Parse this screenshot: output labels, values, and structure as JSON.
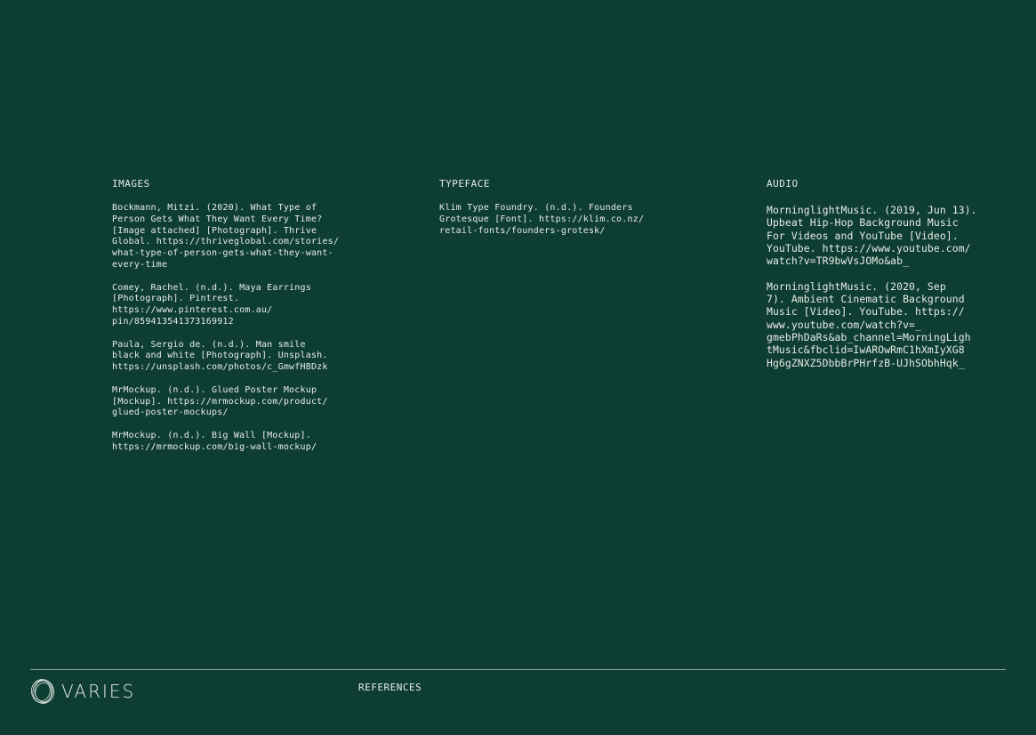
{
  "images": {
    "heading": "IMAGES",
    "entries": [
      [
        "Bockmann, Mitzi. (2020). What Type of",
        "Person Gets What They Want Every Time?",
        "[Image attached] [Photograph]. Thrive",
        "Global. https://thriveglobal.com/stories/",
        "what-type-of-person-gets-what-they-want-",
        "every-time"
      ],
      [
        "Comey, Rachel. (n.d.). Maya Earrings",
        "[Photograph]. Pintrest.",
        "https://www.pinterest.com.au/",
        "pin/859413541373169912"
      ],
      [
        "Paula, Sergio de. (n.d.). Man smile",
        "black and white [Photograph]. Unsplash.",
        "https://unsplash.com/photos/c_GmwfHBDzk"
      ],
      [
        "MrMockup. (n.d.). Glued Poster Mockup",
        "[Mockup]. https://mrmockup.com/product/",
        "glued-poster-mockups/"
      ],
      [
        "MrMockup. (n.d.). Big Wall [Mockup].",
        "https://mrmockup.com/big-wall-mockup/"
      ]
    ]
  },
  "typeface": {
    "heading": "TYPEFACE",
    "entries": [
      [
        "Klim Type Foundry. (n.d.). Founders",
        "Grotesque [Font]. https://klim.co.nz/",
        "retail-fonts/founders-grotesk/"
      ]
    ]
  },
  "audio": {
    "heading": "AUDIO",
    "entries": [
      [
        "MorninglightMusic. (2019, Jun 13).",
        "Upbeat Hip-Hop Background Music",
        "For Videos and YouTube [Video].",
        "YouTube. https://www.youtube.com/",
        "watch?v=TR9bwVsJOMo&ab_"
      ],
      [
        "MorninglightMusic. (2020, Sep",
        "7). Ambient Cinematic Background",
        "Music [Video]. YouTube. https://",
        "www.youtube.com/watch?v=_",
        "gmebPhDaRs&ab_channel=MorningLigh",
        "tMusic&fbclid=IwAROwRmC1hXmIyXG8",
        "Hg6gZNXZ5DbbBrPHrfzB-UJhSObhHqk_"
      ]
    ]
  },
  "footer": {
    "logo_text": "VARIES",
    "title": "REFERENCES",
    "logo_icon": "concentric-rings-icon"
  },
  "colors": {
    "background": "#0d3d33",
    "text": "#e9ece6",
    "rule": "#8aa59c"
  }
}
